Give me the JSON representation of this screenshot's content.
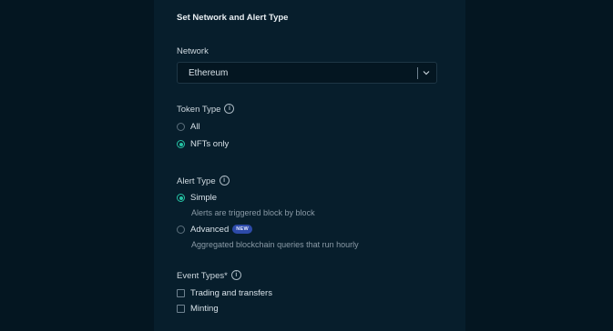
{
  "form": {
    "heading": "Set Network and Alert Type",
    "network": {
      "label": "Network",
      "selected": "Ethereum"
    },
    "token_type": {
      "label": "Token Type",
      "options": [
        {
          "label": "All",
          "checked": false
        },
        {
          "label": "NFTs only",
          "checked": true
        }
      ]
    },
    "alert_type": {
      "label": "Alert Type",
      "options": [
        {
          "label": "Simple",
          "description": "Alerts are triggered block by block",
          "checked": true
        },
        {
          "label": "Advanced",
          "badge": "NEW",
          "description": "Aggregated blockchain queries that run hourly",
          "checked": false
        }
      ]
    },
    "event_types": {
      "label": "Event Types*",
      "options": [
        {
          "label": "Trading and transfers",
          "checked": false
        },
        {
          "label": "Minting",
          "checked": false
        }
      ]
    }
  },
  "colors": {
    "accent": "#25c3a4",
    "background": "#041621",
    "panel": "#071e2c",
    "badge": "#2d4aa8"
  },
  "icons": {
    "info": "info-icon",
    "dropdown": "chevron-down-icon"
  }
}
